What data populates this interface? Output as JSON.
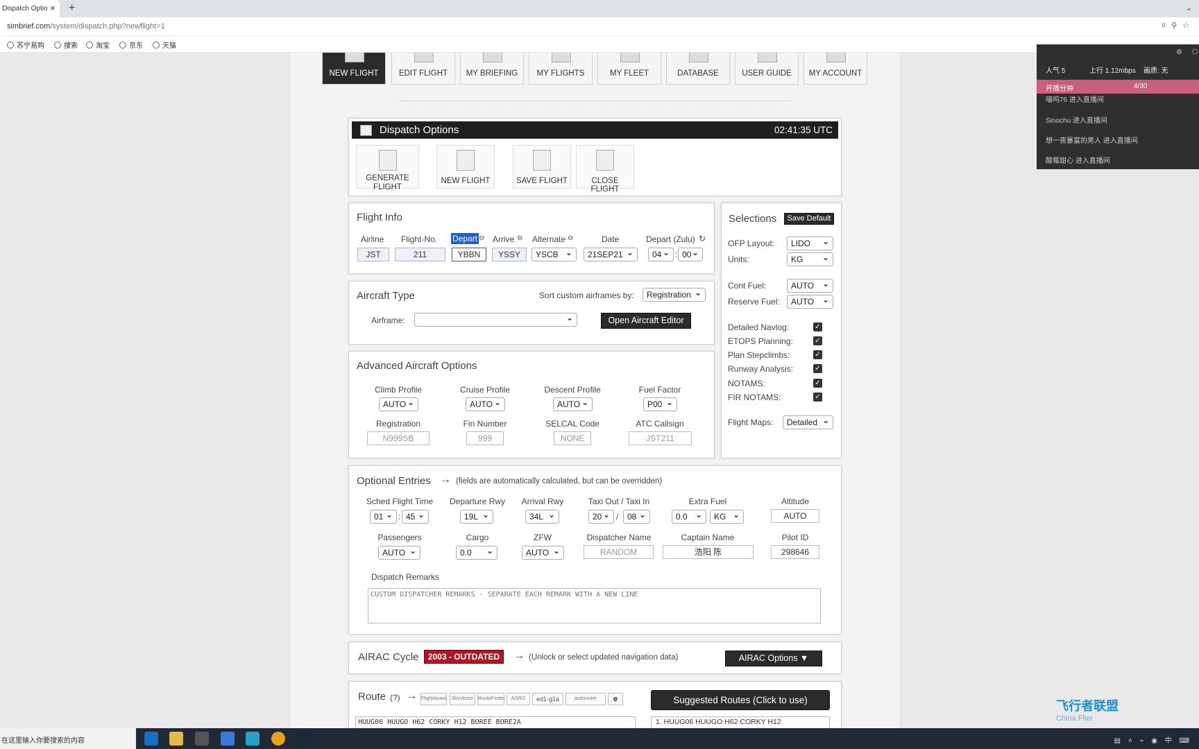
{
  "browser": {
    "tab_title": "Dispatch Optio",
    "url_host": "simbrief.com",
    "url_path": "/system/dispatch.php?newflight=1",
    "bookmarks": [
      "苏宁易购",
      "搜索",
      "淘宝",
      "京东",
      "天猫"
    ]
  },
  "nav": {
    "items": [
      "NEW FLIGHT",
      "EDIT FLIGHT",
      "MY BRIEFING",
      "MY FLIGHTS",
      "MY FLEET",
      "DATABASE",
      "USER GUIDE",
      "MY ACCOUNT"
    ],
    "active": "NEW FLIGHT"
  },
  "dispatch": {
    "title": "Dispatch Options",
    "utc": "02:41:35 UTC",
    "actions": {
      "generate_l1": "GENERATE",
      "generate_l2": "FLIGHT",
      "new": "NEW FLIGHT",
      "save": "SAVE FLIGHT",
      "close": "CLOSE FLIGHT"
    }
  },
  "flight_info": {
    "title": "Flight Info",
    "labels": {
      "airline": "Airline",
      "flight_no": "Flight-No.",
      "depart": "Depart",
      "arrive": "Arrive",
      "alternate": "Alternate",
      "date": "Date",
      "depart_zulu": "Depart (Zulu)"
    },
    "values": {
      "airline": "JST",
      "flight_no": "211",
      "depart": "YBBN",
      "arrive": "YSSY",
      "alternate": "YSCB",
      "date": "21SEP21",
      "hour": "04",
      "minute": "00"
    }
  },
  "aircraft_type": {
    "title": "Aircraft Type",
    "sort_label": "Sort custom airframes by:",
    "sort_value": "Registration",
    "airframe_label": "Airframe:",
    "airframe_value": "",
    "editor_button": "Open Aircraft Editor"
  },
  "advanced": {
    "title": "Advanced Aircraft Options",
    "climb_label": "Climb Profile",
    "climb_value": "AUTO",
    "cruise_label": "Cruise Profile",
    "cruise_value": "AUTO",
    "descent_label": "Descent Profile",
    "descent_value": "AUTO",
    "fuel_factor_label": "Fuel Factor",
    "fuel_factor_value": "P00",
    "registration_label": "Registration",
    "registration_value": "N999SB",
    "fin_label": "Fin Number",
    "fin_value": "999",
    "selcal_label": "SELCAL Code",
    "selcal_value": "NONE",
    "callsign_label": "ATC Callsign",
    "callsign_value": "JST211"
  },
  "selections": {
    "title": "Selections",
    "save_default": "Save Default",
    "ofp_layout_label": "OFP Layout:",
    "ofp_layout_value": "LIDO",
    "units_label": "Units:",
    "units_value": "KG",
    "cont_fuel_label": "Cont Fuel:",
    "cont_fuel_value": "AUTO",
    "reserve_fuel_label": "Reserve Fuel:",
    "reserve_fuel_value": "AUTO",
    "checks": [
      "Detailed Navlog:",
      "ETOPS Planning:",
      "Plan Stepclimbs:",
      "Runway Analysis:",
      "NOTAMS:",
      "FIR NOTAMS:"
    ],
    "flight_maps_label": "Flight Maps:",
    "flight_maps_value": "Detailed"
  },
  "optional": {
    "title": "Optional Entries",
    "arrow": "→",
    "note": "(fields are automatically calculated, but can be overridden)",
    "sched_label": "Sched Flight Time",
    "sched_h": "01",
    "sched_m": "45",
    "dep_rwy_label": "Departure Rwy",
    "dep_rwy": "19L",
    "arr_rwy_label": "Arrival Rwy",
    "arr_rwy": "34L",
    "taxi_label": "Taxi Out / Taxi In",
    "taxi_out": "20",
    "taxi_in": "08",
    "extra_fuel_label": "Extra Fuel",
    "extra_fuel": "0.0",
    "extra_fuel_unit": "KG",
    "altitude_label": "Altitude",
    "altitude": "AUTO",
    "pax_label": "Passengers",
    "pax": "AUTO",
    "cargo_label": "Cargo",
    "cargo": "0.0",
    "zfw_label": "ZFW",
    "zfw": "AUTO",
    "dispatcher_label": "Dispatcher Name",
    "dispatcher_placeholder": "RANDOM",
    "captain_label": "Captain Name",
    "captain": "浩阳 陈",
    "pilot_id_label": "Pilot ID",
    "pilot_id": "298646",
    "remarks_label": "Dispatch Remarks",
    "remarks_placeholder": "CUSTOM DISPATCHER REMARKS - SEPARATE EACH REMARK WITH A NEW LINE"
  },
  "airac": {
    "title": "AIRAC Cycle",
    "badge": "2003 - OUTDATED",
    "arrow": "→",
    "note": "(Unlock or select updated navigation data)",
    "button": "AIRAC Options ▼"
  },
  "route": {
    "title": "Route",
    "help": "(?)",
    "arrow": "→",
    "logos": [
      "FlightAware",
      "SkyVector",
      "RouteFinder",
      "AGRO",
      "ed1-g1a",
      "autorouter",
      "e"
    ],
    "suggested_button": "Suggested Routes (Click to use)",
    "value": "HUUG06 HUUGO H62 CORKY H12 BOREE BORE2A",
    "suggested_1": "1.  HUUG06 HUUGO H62 CORKY H12"
  },
  "overlay": {
    "popularity": "人气  5",
    "upload": "上行  1.12mbps",
    "quality": "画质: 无",
    "share": "开播分钟",
    "count": "4/30",
    "viewers": [
      {
        "name": "喵呜76",
        "action": "进入直播间"
      },
      {
        "name": "Sinochu",
        "action": "进入直播间"
      },
      {
        "name": "想一夜暴富的男人",
        "action": "进入直播间"
      },
      {
        "name": "酸莓甜心",
        "action": "进入直播间"
      }
    ]
  },
  "taskbar": {
    "search": "在这里输入你要搜索的内容"
  },
  "watermark": {
    "title": "飞行者联盟",
    "sub": "China Flier"
  }
}
